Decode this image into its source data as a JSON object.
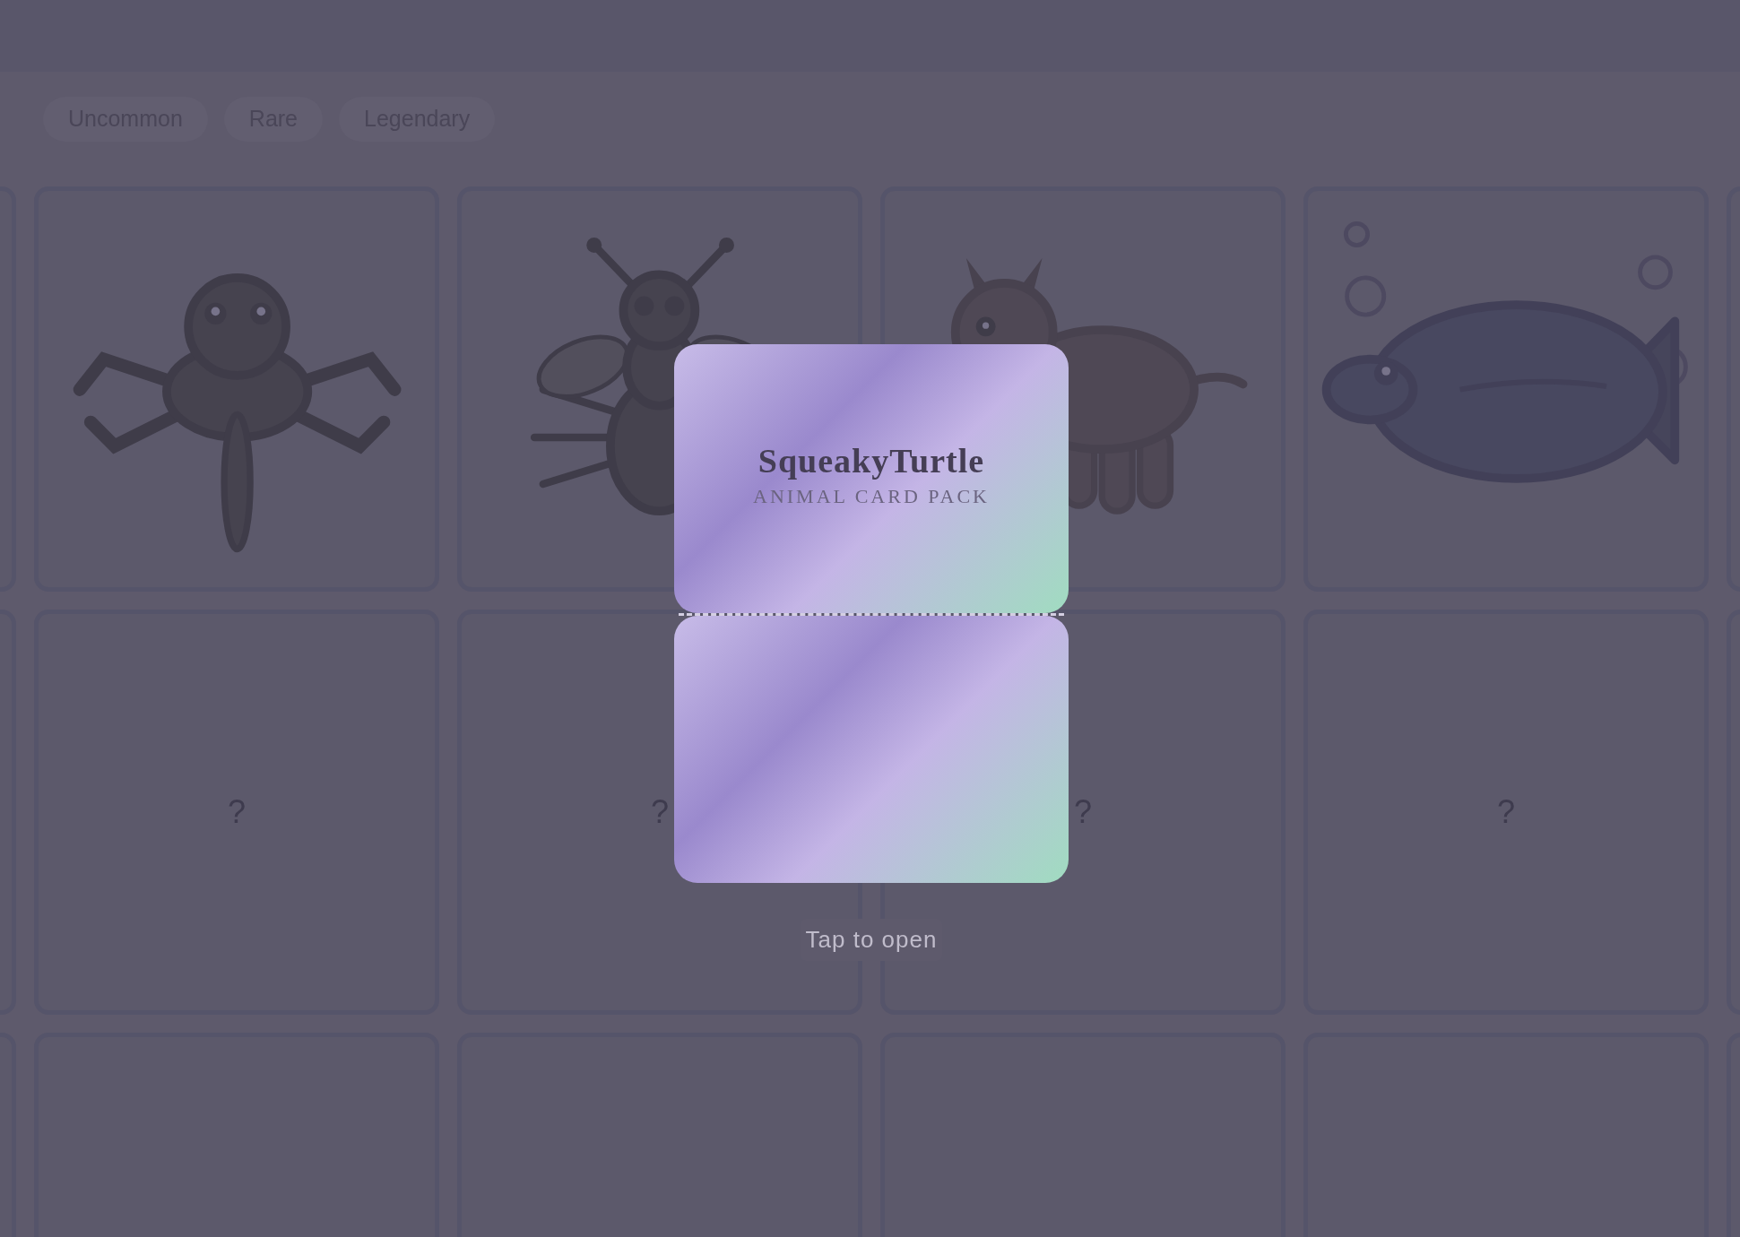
{
  "filters": [
    {
      "label": "Uncommon"
    },
    {
      "label": "Rare"
    },
    {
      "label": "Legendary"
    }
  ],
  "rows": [
    {
      "cards": [
        {
          "kind": "empty"
        },
        {
          "kind": "spider"
        },
        {
          "kind": "bee"
        },
        {
          "kind": "cat"
        },
        {
          "kind": "fish"
        },
        {
          "kind": "empty"
        }
      ]
    },
    {
      "cards": [
        {
          "kind": "empty"
        },
        {
          "kind": "unknown",
          "label": "?"
        },
        {
          "kind": "unknown",
          "label": "?"
        },
        {
          "kind": "unknown",
          "label": "?"
        },
        {
          "kind": "unknown",
          "label": "?"
        },
        {
          "kind": "empty"
        }
      ]
    },
    {
      "cards": [
        {
          "kind": "empty"
        },
        {
          "kind": "empty"
        },
        {
          "kind": "empty"
        },
        {
          "kind": "empty"
        },
        {
          "kind": "empty"
        },
        {
          "kind": "empty"
        }
      ]
    }
  ],
  "pack": {
    "title": "SqueakyTurtle",
    "subtitle": "ANIMAL CARD PACK",
    "hint": "Tap to open"
  }
}
